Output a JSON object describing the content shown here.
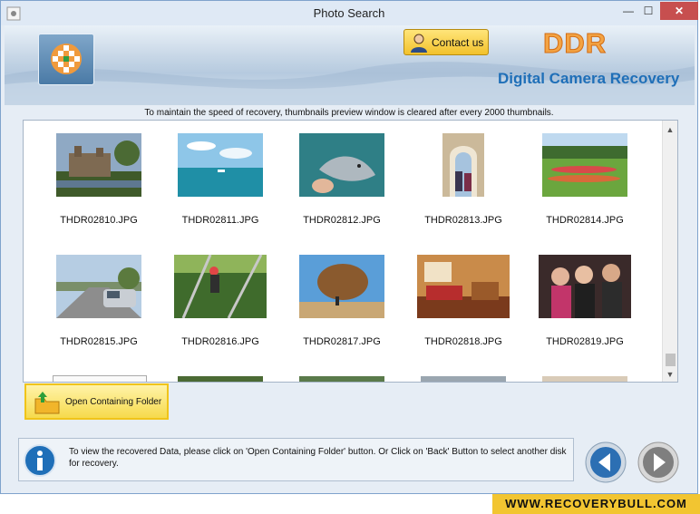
{
  "window": {
    "title": "Photo Search",
    "min_glyph": "—",
    "max_glyph": "☐",
    "close_glyph": "✕"
  },
  "header": {
    "contact_label": "Contact us",
    "brand": "DDR",
    "product": "Digital Camera Recovery"
  },
  "notice": "To maintain the speed of recovery, thumbnails preview window is cleared after every 2000 thumbnails.",
  "thumbnails": [
    {
      "name": "THDR02810.JPG",
      "icon": "castle-photo"
    },
    {
      "name": "THDR02811.JPG",
      "icon": "sea-photo"
    },
    {
      "name": "THDR02812.JPG",
      "icon": "dolphin-photo"
    },
    {
      "name": "THDR02813.JPG",
      "icon": "mosque-photo"
    },
    {
      "name": "THDR02814.JPG",
      "icon": "garden-photo"
    },
    {
      "name": "THDR02815.JPG",
      "icon": "road-car-photo"
    },
    {
      "name": "THDR02816.JPG",
      "icon": "climber-photo"
    },
    {
      "name": "THDR02817.JPG",
      "icon": "boulder-photo"
    },
    {
      "name": "THDR02818.JPG",
      "icon": "hotel-room-photo"
    },
    {
      "name": "THDR02819.JPG",
      "icon": "people-photo"
    }
  ],
  "scroll": {
    "up_glyph": "▲",
    "down_glyph": "▼"
  },
  "actions": {
    "open_folder_label": "Open Containing Folder"
  },
  "info": {
    "text": "To view the recovered Data, please click on 'Open Containing Folder' button. Or Click on 'Back' Button to select another disk for recovery."
  },
  "footer": {
    "site": "WWW.RECOVERYBULL.COM"
  },
  "colors": {
    "accent": "#f2c531",
    "brand_orange": "#f3a343",
    "product_blue": "#1f6fb8"
  }
}
